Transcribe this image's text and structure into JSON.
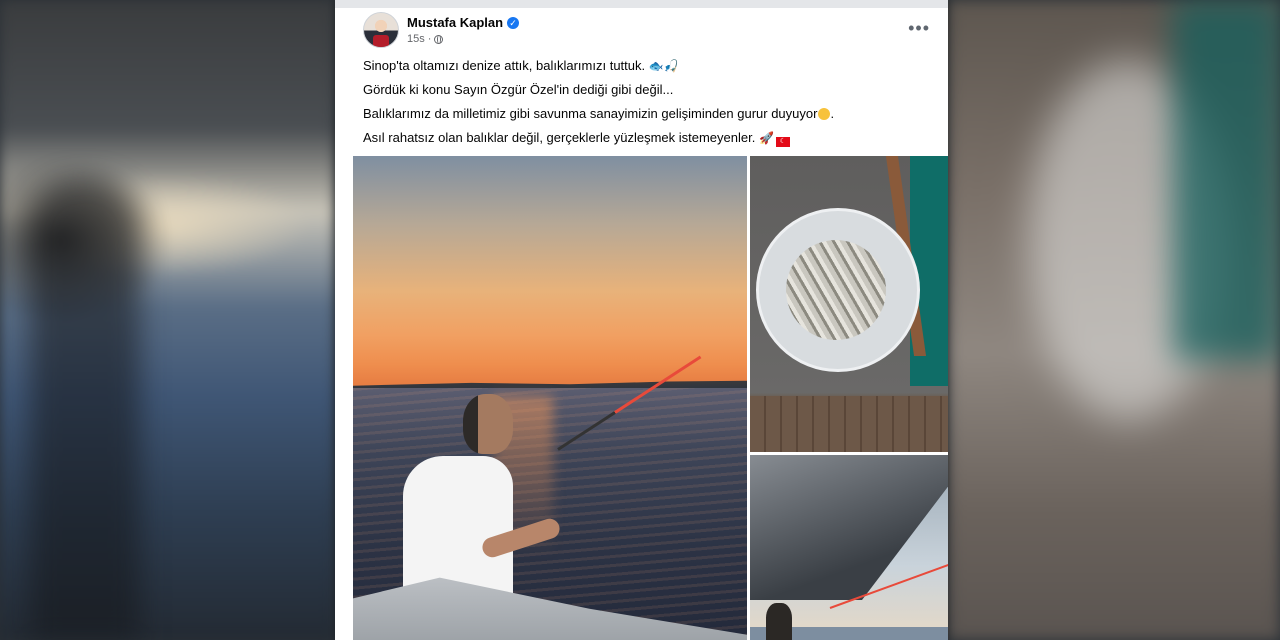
{
  "post": {
    "author_name": "Mustafa Kaplan",
    "timestamp": "15s",
    "dot": "·",
    "more_label": "•••",
    "paragraphs": [
      "Sinop'ta oltamızı denize attık, balıklarımızı tuttuk.",
      "Gördük ki konu Sayın Özgür Özel'in dediği gibi değil...",
      "Balıklarımız da milletimiz gibi savunma sanayimizin gelişiminden gurur duyuyor",
      "Asıl rahatsız olan balıklar değil, gerçeklerle yüzleşmek istemeyenler."
    ],
    "icons": {
      "verified": "verified-badge-icon",
      "privacy": "globe-icon",
      "more": "more-options-icon",
      "p1_emojis": [
        "fish-icon",
        "fishing-pole-icon"
      ],
      "p3_emoji": "smiling-face-icon",
      "p4_emojis": [
        "rocket-icon",
        "turkish-flag-icon"
      ]
    },
    "photos": [
      "main-photo",
      "fish-bowl-photo",
      "boat-photo"
    ]
  },
  "colors": {
    "verified_badge": "#1877f2",
    "text": "#050505",
    "meta_text": "#65676b"
  }
}
